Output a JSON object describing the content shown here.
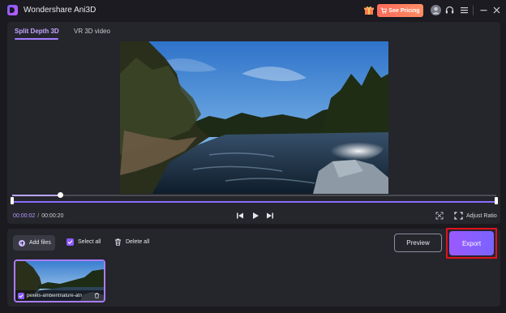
{
  "app": {
    "title": "Wondershare Ani3D",
    "pricing_label": "See Pricing"
  },
  "tabs": [
    {
      "label": "Split Depth 3D",
      "active": true
    },
    {
      "label": "VR 3D video",
      "active": false
    }
  ],
  "player": {
    "current_time": "00:00:02",
    "separator": "/",
    "total_time": "00:00:20",
    "progress": 0.1,
    "adjust_ratio_label": "Adjust Ratio"
  },
  "toolbar": {
    "add_files_label": "Add files",
    "select_all_label": "Select all",
    "delete_all_label": "Delete all",
    "preview_label": "Preview",
    "export_label": "Export"
  },
  "files": [
    {
      "name": "pexels-ambientnature-atn",
      "checked": true
    }
  ],
  "colors": {
    "accent": "#8a5cff",
    "pricing": "#ff6a5a",
    "highlight_box": "#e0121a",
    "background": "#1a1a1f",
    "panel": "#25252c"
  },
  "icons": [
    "app-logo-icon",
    "gift-icon",
    "user-avatar-icon",
    "headset-icon",
    "menu-icon",
    "minimize-icon",
    "close-icon",
    "skip-back-icon",
    "play-icon",
    "skip-forward-icon",
    "fullscreen-icon",
    "adjust-ratio-icon",
    "plus-icon",
    "checkbox-icon",
    "trash-icon"
  ]
}
